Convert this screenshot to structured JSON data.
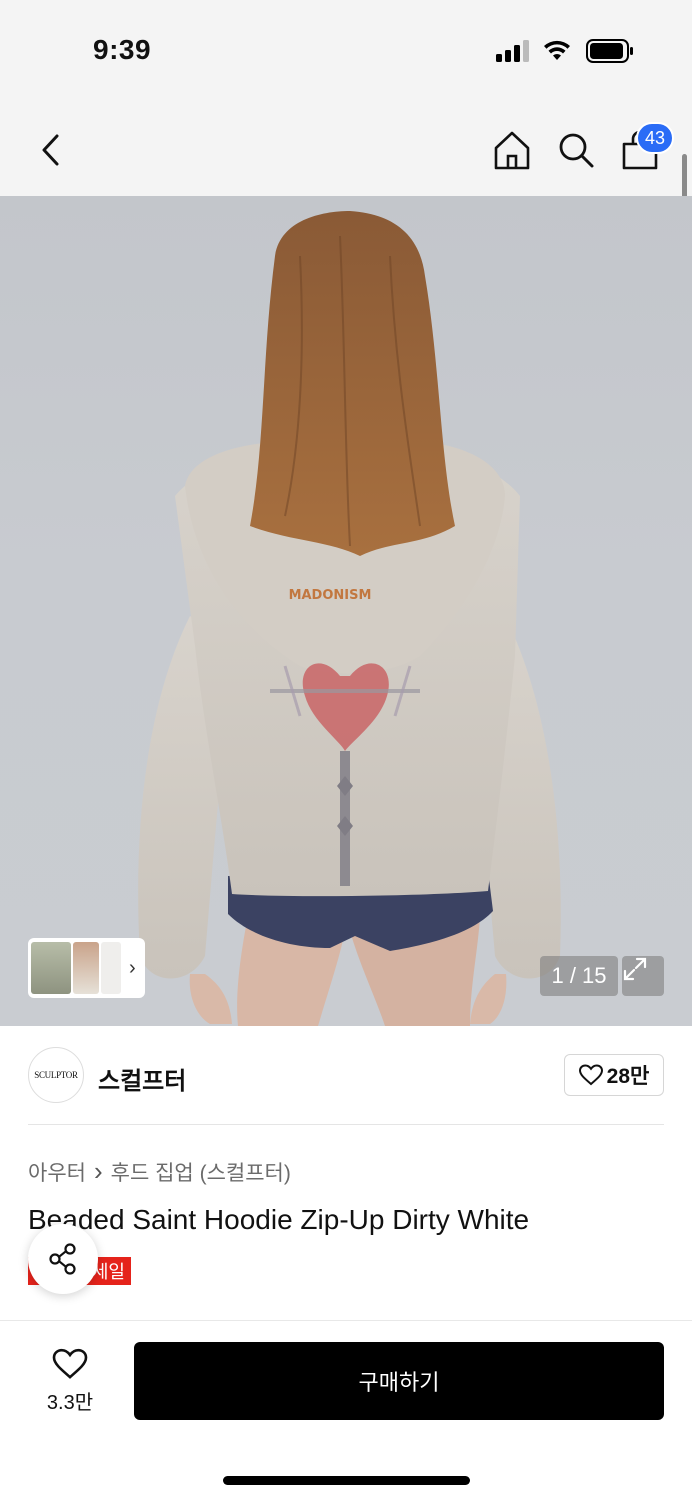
{
  "status_bar": {
    "time": "9:39"
  },
  "nav": {
    "cart_count": "43"
  },
  "gallery": {
    "counter": "1 / 15",
    "thumb_chevron": "›"
  },
  "brand": {
    "logo_text": "SCULPTOR",
    "name": "스컬프터",
    "likes": "28만"
  },
  "breadcrumb": {
    "category": "아우터",
    "separator": "›",
    "subcategory": "후드 집업 (스컬프터)"
  },
  "product": {
    "title": "Beaded Saint Hoodie Zip-Up Dirty White",
    "sale_badge": "세일"
  },
  "bottom_bar": {
    "wish_count": "3.3만",
    "buy_label": "구매하기"
  },
  "colors": {
    "accent_blue": "#2a6cf6",
    "sale_red": "#e5231b",
    "buy_black": "#000000"
  },
  "icons": [
    "back-icon",
    "home-icon",
    "search-icon",
    "cart-icon",
    "expand-icon",
    "heart-icon",
    "share-icon",
    "chevron-right-icon"
  ]
}
